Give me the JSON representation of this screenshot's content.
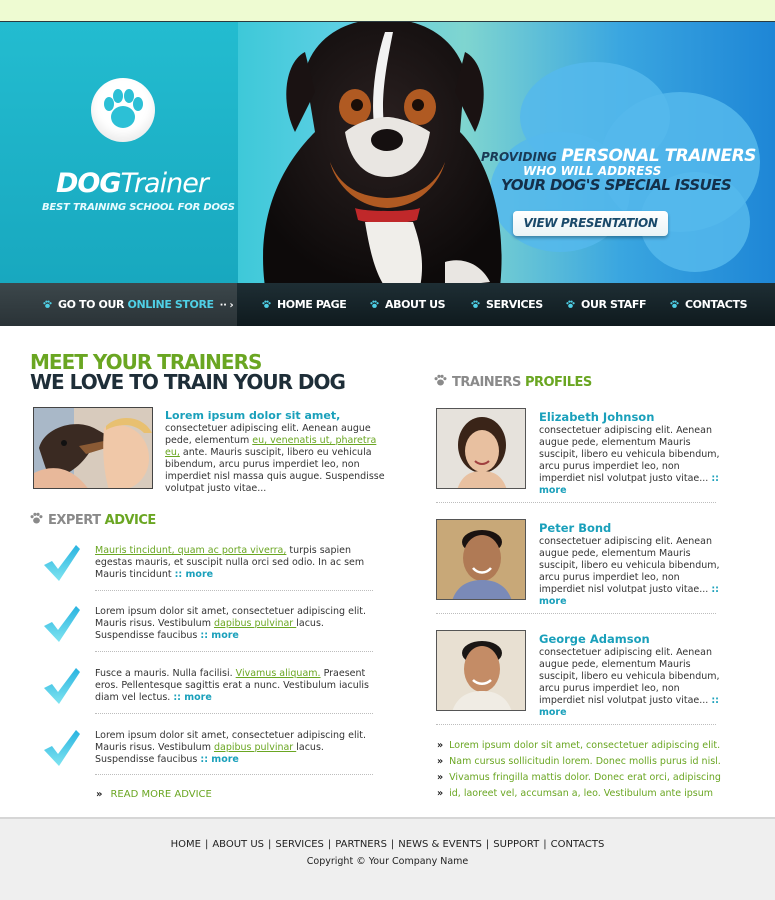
{
  "header": {
    "logo_bold": "DOG",
    "logo_light": "Trainer",
    "logo_tagline": "BEST TRAINING SCHOOL FOR DOGS",
    "tag_providing": "PROVIDING",
    "tag_personal": "PERSONAL TRAINERS",
    "tag_who": "WHO WILL ADDRESS",
    "tag_special": "YOUR DOG'S SPECIAL ISSUES",
    "presentation_button": "VIEW PRESENTATION"
  },
  "nav": {
    "store_prefix": "GO TO OUR",
    "store_accent": "ONLINE STORE",
    "store_arrow": "·· ›",
    "items": [
      {
        "label": "HOME PAGE"
      },
      {
        "label": "ABOUT US"
      },
      {
        "label": "SERVICES"
      },
      {
        "label": "OUR STAFF"
      },
      {
        "label": "CONTACTS"
      }
    ]
  },
  "intro": {
    "heading_top": "MEET YOUR TRAINERS",
    "heading_bottom": "WE LOVE TO TRAIN YOUR DOG",
    "lead": "Lorem ipsum dolor sit amet,",
    "text_a": " consectetuer adipiscing elit. Aenean augue pede, elementum ",
    "link": "eu, venenatis ut, pharetra eu,",
    "text_b": " ante. Mauris suscipit, libero eu vehicula bibendum, arcu purus imperdiet leo, non imperdiet nisl massa quis augue. Suspendisse volutpat justo vitae..."
  },
  "advice": {
    "title_grey": "EXPERT",
    "title_green": "ADVICE",
    "items": [
      {
        "link": "Mauris tincidunt, quam ac porta viverra,",
        "text_pre": "",
        "text_post": " turpis sapien egestas mauris, et suscipit nulla orci sed odio. In ac sem Mauris tincidunt ",
        "more": ":: more"
      },
      {
        "link": "dapibus pulvinar ",
        "text_pre": "Lorem ipsum dolor sit amet, consectetuer adipiscing elit. Mauris risus. Vestibulum ",
        "text_post": "lacus. Suspendisse faucibus ",
        "more": ":: more"
      },
      {
        "link": "Vivamus aliquam.",
        "text_pre": "Fusce a mauris. Nulla facilisi. ",
        "text_post": " Praesent eros. Pellentesque sagittis erat a nunc. Vestibulum iaculis diam vel lectus. ",
        "more": ":: more"
      },
      {
        "link": "dapibus pulvinar ",
        "text_pre": "Lorem ipsum dolor sit amet, consectetuer adipiscing elit. Mauris risus. Vestibulum ",
        "text_post": "lacus. Suspendisse faucibus ",
        "more": ":: more"
      }
    ],
    "read_more_chev": "»",
    "read_more": "READ MORE ADVICE"
  },
  "trainers": {
    "title_grey": "TRAINERS",
    "title_green": "PROFILES",
    "items": [
      {
        "name": "Elizabeth Johnson",
        "desc": "consectetuer adipiscing elit. Aenean augue pede, elementum Mauris suscipit, libero eu vehicula bibendum, arcu purus imperdiet leo, non imperdiet nisl volutpat justo vitae... ",
        "more": ":: more"
      },
      {
        "name": "Peter Bond",
        "desc": "consectetuer adipiscing elit. Aenean augue pede, elementum Mauris suscipit, libero eu vehicula bibendum, arcu purus imperdiet leo, non imperdiet nisl volutpat justo vitae... ",
        "more": ":: more"
      },
      {
        "name": "George Adamson",
        "desc": "consectetuer adipiscing elit. Aenean augue pede, elementum Mauris suscipit, libero eu vehicula bibendum, arcu purus imperdiet leo, non imperdiet nisl volutpat justo vitae... ",
        "more": ":: more"
      }
    ],
    "bullets": [
      {
        "chev": "»",
        "text": "Lorem ipsum dolor sit amet, consectetuer adipiscing elit."
      },
      {
        "chev": "»",
        "text": "Nam cursus sollicitudin lorem. Donec mollis purus id nisl."
      },
      {
        "chev": "»",
        "text": "Vivamus fringilla mattis dolor. Donec erat orci, adipiscing"
      },
      {
        "chev": "»",
        "text": "id, laoreet vel, accumsan a, leo. Vestibulum ante ipsum"
      }
    ]
  },
  "footer": {
    "links": [
      {
        "label": "HOME"
      },
      {
        "label": "ABOUT US"
      },
      {
        "label": "SERVICES"
      },
      {
        "label": "PARTNERS"
      },
      {
        "label": "NEWS & EVENTS"
      },
      {
        "label": "SUPPORT"
      },
      {
        "label": "CONTACTS"
      }
    ],
    "separator": "|",
    "copyright": "Copyright © Your Company Name"
  },
  "colors": {
    "accent_green": "#6aa622",
    "accent_teal": "#1aa0bb",
    "nav_dark": "#0f1a1e"
  }
}
